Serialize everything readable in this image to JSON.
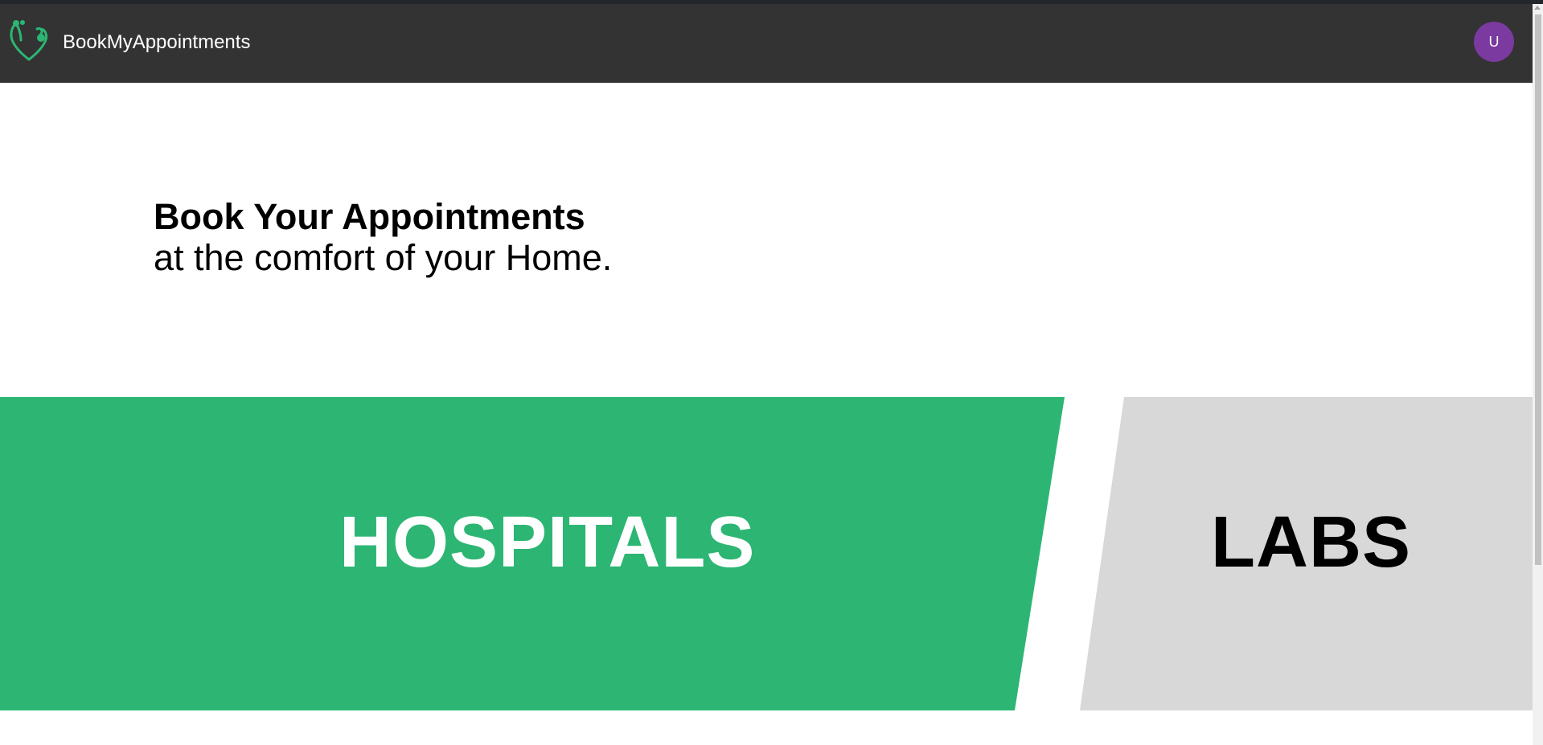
{
  "navbar": {
    "brand_name": "BookMyAppointments",
    "logo_icon": "stethoscope-heart-icon",
    "background_color": "#333333",
    "user_avatar_initial": "U",
    "avatar_color": "#7b3aa0"
  },
  "hero": {
    "title": "Book Your Appointments",
    "subtitle": "at the comfort of your Home."
  },
  "panels": {
    "hospitals": {
      "label": "HOSPITALS",
      "color": "#2db673"
    },
    "labs": {
      "label": "LABS",
      "color": "#d8d8d8"
    }
  }
}
